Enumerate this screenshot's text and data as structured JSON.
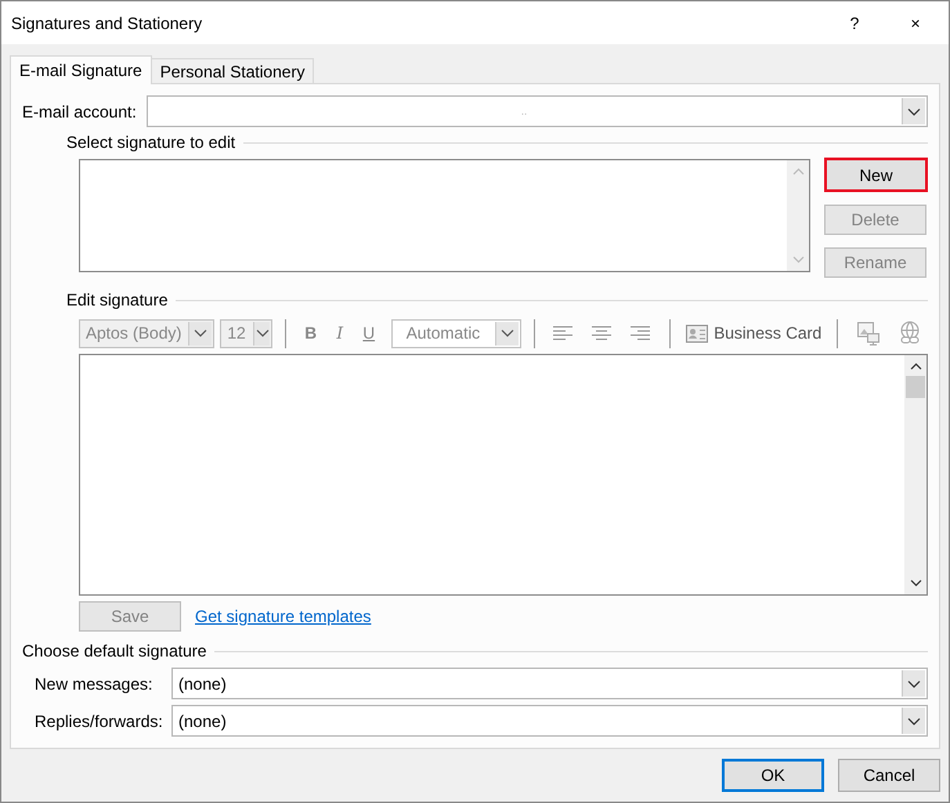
{
  "window": {
    "title": "Signatures and Stationery",
    "help": "?",
    "close": "×"
  },
  "tabs": [
    {
      "label": "E-mail Signature",
      "selected": true
    },
    {
      "label": "Personal Stationery",
      "selected": false
    }
  ],
  "email_account": {
    "label": "E-mail account:",
    "value": ".."
  },
  "select_section": {
    "heading": "Select signature to edit",
    "buttons": [
      {
        "label": "New",
        "disabled": false,
        "highlighted": true
      },
      {
        "label": "Delete",
        "disabled": true,
        "highlighted": false
      },
      {
        "label": "Rename",
        "disabled": true,
        "highlighted": false
      }
    ]
  },
  "edit_section": {
    "heading": "Edit signature",
    "toolbar": {
      "font": "Aptos (Body)",
      "size": "12",
      "bold": "B",
      "italic": "I",
      "underline": "U",
      "colour_choice": "Automatic",
      "business_card": "Business Card",
      "disabled": true
    },
    "save": {
      "label": "Save",
      "disabled": true
    },
    "link": "Get signature templates"
  },
  "default_section": {
    "heading": "Choose default signature",
    "rows": [
      {
        "label": "New messages:",
        "value": "(none)"
      },
      {
        "label": "Replies/forwards:",
        "value": "(none)"
      }
    ]
  },
  "footer_buttons": [
    {
      "label": "OK",
      "default": true
    },
    {
      "label": "Cancel",
      "default": false
    }
  ]
}
